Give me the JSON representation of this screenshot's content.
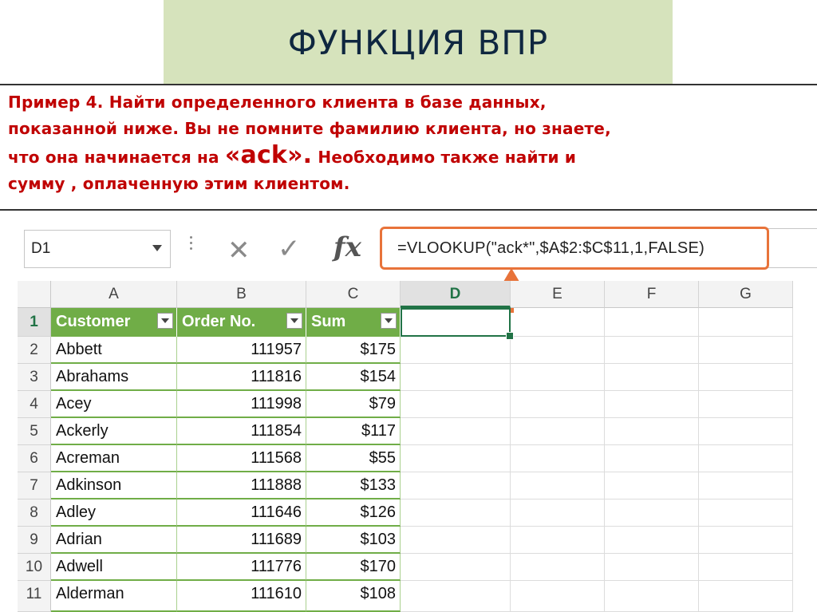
{
  "title": "ФУНКЦИЯ ВПР",
  "description": {
    "line1": "Пример 4. Найти  определенного клиента в базе данных,",
    "line2": "показанной ниже. Вы не помните  фамилию клиента, но знаете,",
    "line3_pre": "что она начинается на ",
    "line3_big": "«ack».",
    "line3_post": " Необходимо также найти и",
    "line4": "сумму , оплаченную этим клиентом."
  },
  "excel": {
    "name_box": "D1",
    "formula": "=VLOOKUP(\"ack*\",$A$2:$C$11,1,FALSE)",
    "icons": {
      "cancel": "cancel-x-icon",
      "enter": "checkmark-icon",
      "function": "fx-icon"
    },
    "accent_color": "#e8733a",
    "table_color": "#70ad47",
    "column_headers": [
      "A",
      "B",
      "C",
      "D",
      "E",
      "F",
      "G"
    ],
    "active_column": "D",
    "row_numbers": [
      "1",
      "2",
      "3",
      "4",
      "5",
      "6",
      "7",
      "8",
      "9",
      "10",
      "11"
    ],
    "table_headers": [
      "Customer",
      "Order No.",
      "Sum"
    ],
    "rows": [
      [
        "Abbett",
        "111957",
        "$175"
      ],
      [
        "Abrahams",
        "111816",
        "$154"
      ],
      [
        "Acey",
        "111998",
        "$79"
      ],
      [
        "Ackerly",
        "111854",
        "$117"
      ],
      [
        "Acreman",
        "111568",
        "$55"
      ],
      [
        "Adkinson",
        "111888",
        "$133"
      ],
      [
        "Adley",
        "111646",
        "$126"
      ],
      [
        "Adrian",
        "111689",
        "$103"
      ],
      [
        "Adwell",
        "111776",
        "$170"
      ],
      [
        "Alderman",
        "111610",
        "$108"
      ]
    ]
  }
}
